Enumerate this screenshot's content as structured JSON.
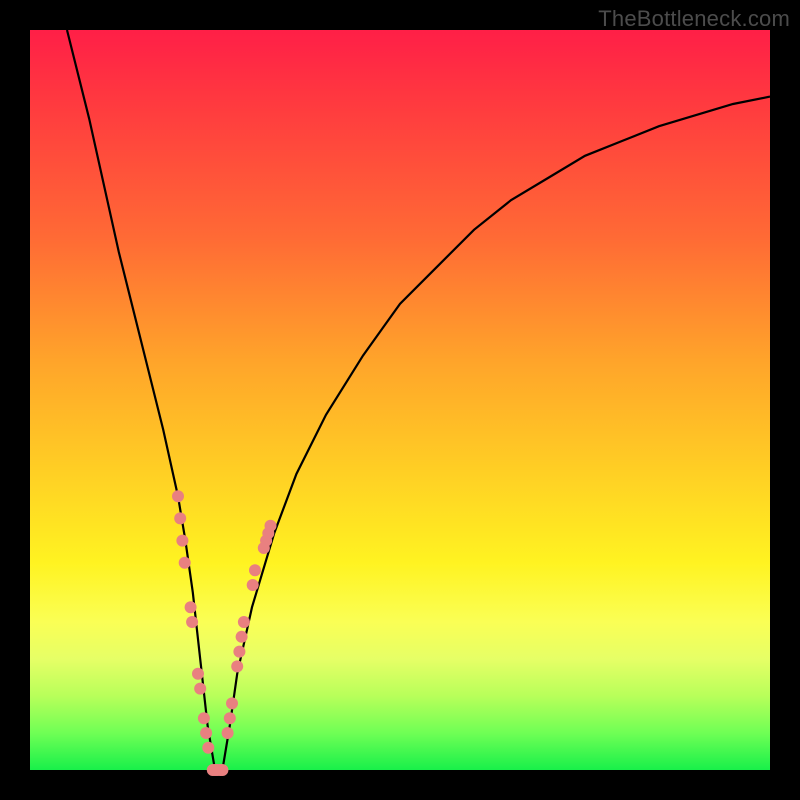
{
  "domain": "Chart",
  "watermark": "TheBottleneck.com",
  "chart_data": {
    "type": "line",
    "title": "",
    "xlabel": "",
    "ylabel": "",
    "xlim": [
      0,
      100
    ],
    "ylim": [
      0,
      100
    ],
    "grid": false,
    "legend": false,
    "background_gradient": {
      "direction": "vertical",
      "stops": [
        {
          "pos": 0,
          "color": "#ff1f47"
        },
        {
          "pos": 28,
          "color": "#ff6a35"
        },
        {
          "pos": 60,
          "color": "#ffd024"
        },
        {
          "pos": 80,
          "color": "#faff55"
        },
        {
          "pos": 100,
          "color": "#18f04a"
        }
      ]
    },
    "series": [
      {
        "name": "bottleneck-curve",
        "style": "solid",
        "color": "#000000",
        "x": [
          5,
          8,
          10,
          12,
          14,
          16,
          18,
          20,
          21,
          22,
          23,
          24,
          25,
          26,
          27,
          28,
          30,
          33,
          36,
          40,
          45,
          50,
          55,
          60,
          65,
          70,
          75,
          80,
          85,
          90,
          95,
          100
        ],
        "y": [
          100,
          88,
          79,
          70,
          62,
          54,
          46,
          37,
          31,
          24,
          15,
          6,
          0,
          0,
          6,
          13,
          22,
          32,
          40,
          48,
          56,
          63,
          68,
          73,
          77,
          80,
          83,
          85,
          87,
          88.5,
          90,
          91
        ]
      }
    ],
    "annotations": [
      {
        "name": "left-branch-markers",
        "type": "scatter-strip",
        "color": "#e98080",
        "radius_px": 6,
        "points_xy": [
          [
            20.0,
            37
          ],
          [
            20.3,
            34
          ],
          [
            20.6,
            31
          ],
          [
            20.9,
            28
          ],
          [
            21.7,
            22
          ],
          [
            21.9,
            20
          ],
          [
            22.7,
            13
          ],
          [
            23.0,
            11
          ],
          [
            23.5,
            7
          ],
          [
            23.8,
            5
          ],
          [
            24.1,
            3
          ],
          [
            24.7,
            0
          ],
          [
            25.0,
            0
          ],
          [
            25.3,
            0
          ]
        ]
      },
      {
        "name": "right-branch-markers",
        "type": "scatter-strip",
        "color": "#e98080",
        "radius_px": 6,
        "points_xy": [
          [
            25.7,
            0
          ],
          [
            26.0,
            0
          ],
          [
            26.7,
            5
          ],
          [
            27.0,
            7
          ],
          [
            27.3,
            9
          ],
          [
            28.0,
            14
          ],
          [
            28.3,
            16
          ],
          [
            28.6,
            18
          ],
          [
            28.9,
            20
          ],
          [
            30.1,
            25
          ],
          [
            30.4,
            27
          ],
          [
            31.6,
            30
          ],
          [
            31.9,
            31
          ],
          [
            32.2,
            32
          ],
          [
            32.5,
            33
          ]
        ]
      }
    ],
    "curve_minimum": {
      "x": 25.5,
      "y": 0
    }
  }
}
